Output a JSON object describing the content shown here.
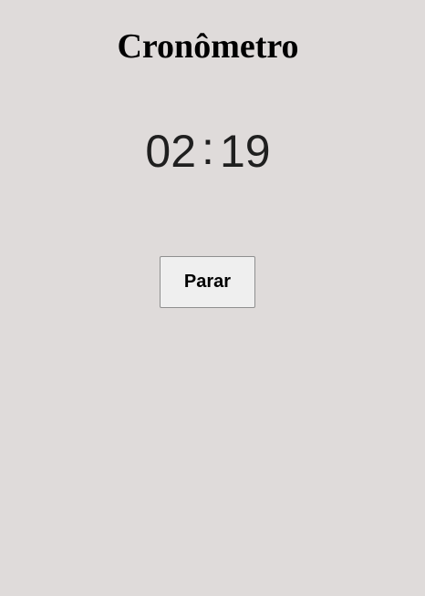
{
  "header": {
    "title": "Cronômetro"
  },
  "timer": {
    "minutes": "02",
    "separator": ":",
    "seconds": "19"
  },
  "controls": {
    "stop_label": "Parar"
  },
  "colors": {
    "background": "#dfdbda",
    "button_background": "#efefef",
    "button_border": "#8f8f8f",
    "time_text": "#1f1f1f"
  }
}
